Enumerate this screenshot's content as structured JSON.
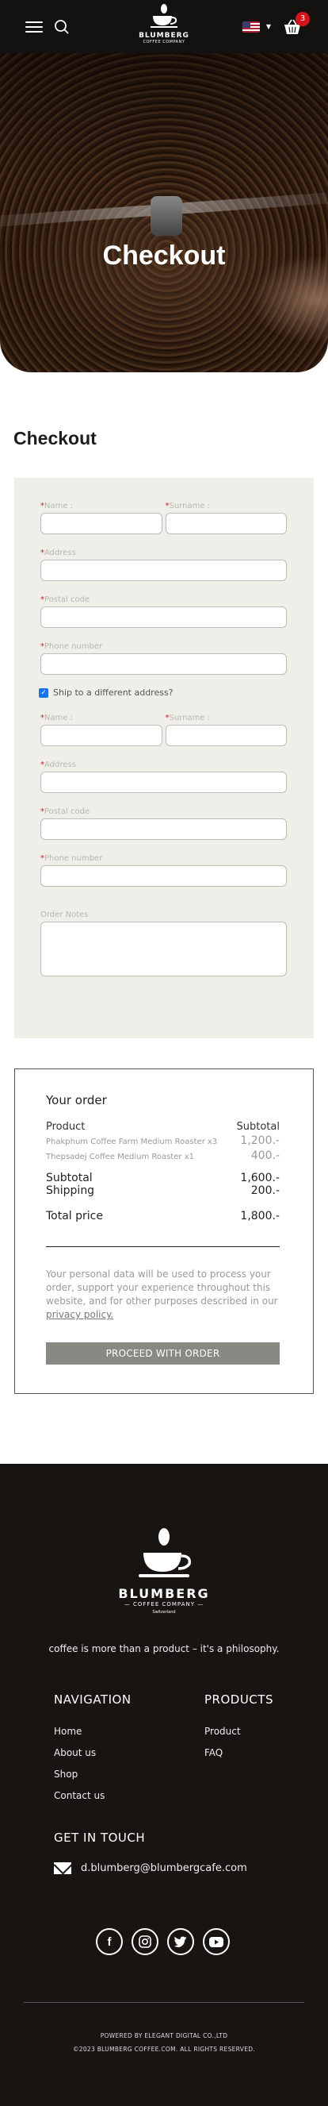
{
  "header": {
    "logo_brand": "BLUMBERG",
    "logo_sub": "COFFEE COMPANY",
    "cart_count": "3",
    "icons": [
      "menu-icon",
      "search-icon",
      "us-flag-icon",
      "chevron-down-icon",
      "cart-icon"
    ]
  },
  "hero": {
    "title": "Checkout"
  },
  "page": {
    "title": "Checkout"
  },
  "billing": {
    "name_label": "Name :",
    "surname_label": "Surname :",
    "address_label": "Address",
    "postal_label": "Postal code",
    "phone_label": "Phone number"
  },
  "ship_different": {
    "label": "Ship to a different address?",
    "checked": true
  },
  "shipping": {
    "name_label": "Name :",
    "surname_label": "Surname :",
    "address_label": "Address",
    "postal_label": "Postal code",
    "phone_label": "Phone number",
    "notes_label": "Order Notes"
  },
  "order": {
    "title": "Your order",
    "col_product": "Product",
    "col_subtotal": "Subtotal",
    "items": [
      {
        "name": "Phakphum Coffee Farm Medium Roaster x3",
        "price": "1,200.-"
      },
      {
        "name": "Thepsadej Coffee Medium Roaster x1",
        "price": "400.-"
      }
    ],
    "subtotal_label": "Subtotal",
    "subtotal_value": "1,600.-",
    "shipping_label": "Shipping",
    "shipping_value": "200.-",
    "total_label": "Total price",
    "total_value": "1,800.-",
    "privacy_text": "Your personal data will be used to process your order, support your experience throughout this website, and for other purposes described in our",
    "privacy_link": "privacy policy.",
    "proceed_label": "PROCEED WITH ORDER"
  },
  "footer": {
    "logo_brand": "BLUMBERG",
    "logo_sub": "— COFFEE COMPANY —",
    "logo_country": "Switzerland",
    "tagline": "coffee is more than a product – it's a philosophy.",
    "nav_title": "NAVIGATION",
    "nav_links": [
      "Home",
      "About us",
      "Shop",
      "Contact us"
    ],
    "products_title": "PRODUCTS",
    "product_links": [
      "Product",
      "FAQ"
    ],
    "touch_title": "GET IN TOUCH",
    "email": "d.blumberg@blumbergcafe.com",
    "socials": [
      "facebook-icon",
      "instagram-icon",
      "twitter-icon",
      "youtube-icon"
    ],
    "powered": "POWERED BY ELEGANT DIGITAL CO.,LTD",
    "copyright": "©2023 BLUMBERG COFFEE.COM. ALL RIGHTS RESERVED."
  }
}
